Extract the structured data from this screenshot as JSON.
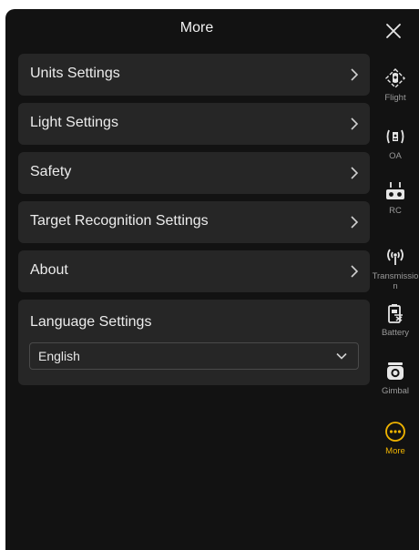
{
  "header": {
    "title": "More"
  },
  "menu": {
    "items": [
      {
        "label": "Units Settings"
      },
      {
        "label": "Light Settings"
      },
      {
        "label": "Safety"
      },
      {
        "label": "Target Recognition Settings"
      },
      {
        "label": "About"
      }
    ]
  },
  "language": {
    "title": "Language Settings",
    "selected": "English"
  },
  "sidebar": {
    "items": [
      {
        "label": "Flight",
        "icon": "drone-icon"
      },
      {
        "label": "OA",
        "icon": "obstacle-avoidance-icon"
      },
      {
        "label": "RC",
        "icon": "remote-controller-icon"
      },
      {
        "label": "Transmission",
        "icon": "transmission-icon"
      },
      {
        "label": "Battery",
        "icon": "battery-icon"
      },
      {
        "label": "Gimbal",
        "icon": "gimbal-icon"
      },
      {
        "label": "More",
        "icon": "more-icon"
      }
    ],
    "active_color": "#f0b400"
  },
  "colors": {
    "panel_bg": "#121212",
    "row_bg": "#262626",
    "accent": "#f0b400"
  }
}
